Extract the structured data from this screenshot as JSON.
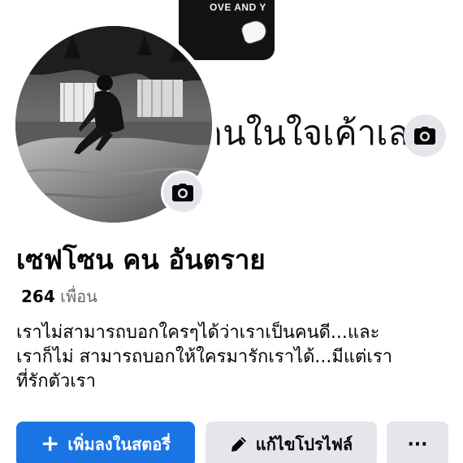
{
  "cover": {
    "shirt_text": "OVE AND Y",
    "caption": "คนในใจเค้าเล"
  },
  "profile": {
    "name": "เซฟโซน คน อันตราย",
    "friends_count": "264",
    "friends_label": "เพื่อน",
    "bio_lines": [
      "เราไม่สามารถบอกใครๆได้ว่าเราเป็นคนดี...และ",
      "เราก็ไม่ สามารถบอกให้ใครมารักเราได้...มีแต่เรา",
      "ที่รักตัวเรา"
    ]
  },
  "actions": {
    "add_story_label": "เพิ่มลงในสตอรี่",
    "edit_profile_label": "แก้ไขโปรไฟล์",
    "more_label": "···"
  },
  "icons": {
    "cover_camera": "camera-icon",
    "avatar_camera": "camera-icon",
    "add": "plus-icon",
    "edit": "pencil-icon",
    "more": "ellipsis-icon"
  },
  "colors": {
    "primary": "#1b74e4",
    "secondary": "#e4e6eb",
    "text": "#050505",
    "muted": "#65676b"
  }
}
